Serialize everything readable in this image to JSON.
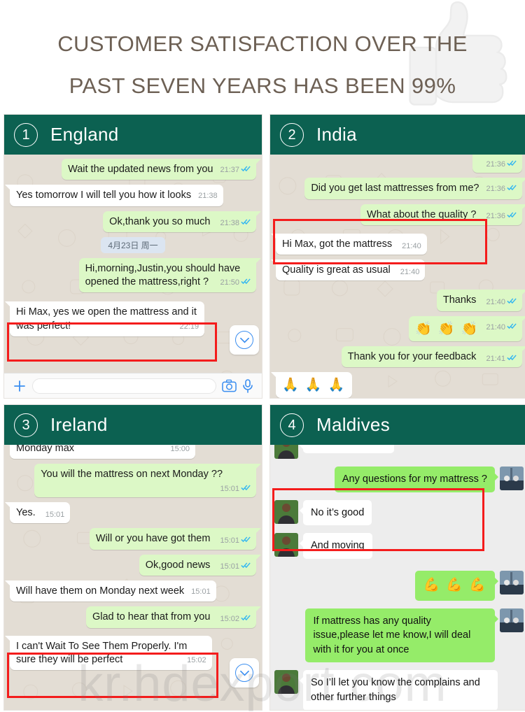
{
  "header": {
    "line1": "CUSTOMER SATISFACTION OVER THE",
    "line2": "PAST SEVEN YEARS HAS BEEN 99%",
    "text_color": "#6d6054",
    "watermark_icon": "thumbs-up-icon"
  },
  "theme": {
    "header_green": "#0c6151",
    "out_bubble_green": "#dcf8c6",
    "in_bubble_white": "#ffffff",
    "chat_background": "#e3ddd4",
    "wechat_background": "#ededed",
    "wechat_out_green": "#95ec69",
    "highlight_red": "#f41c1c",
    "accent_blue": "#3b8ef0",
    "tick_blue": "#34b7f1"
  },
  "panels": [
    {
      "number": "1",
      "title": "England",
      "style": "whatsapp",
      "messages": [
        {
          "side": "right",
          "text": "Wait the updated news from you",
          "time": "21:37",
          "ticks": "read"
        },
        {
          "side": "left",
          "text": "Yes tomorrow I will tell you how it looks",
          "time": "21:38",
          "ticks": "none"
        },
        {
          "side": "right",
          "text": "Ok,thank you so much",
          "time": "21:38",
          "ticks": "read",
          "inline_meta": true
        },
        {
          "side": "center",
          "text": "4月23日 周一",
          "type": "date"
        },
        {
          "side": "right",
          "text": "Hi,morning,Justin,you should have opened the mattress,right ?",
          "time": "21:50",
          "ticks": "read"
        },
        {
          "side": "left",
          "text": "Hi Max, yes we open the mattress and it was perfect!",
          "time": "22:19",
          "ticks": "none",
          "highlighted": true
        }
      ],
      "has_input_bar": true,
      "input_bar": {
        "plus_icon": "plus-icon",
        "input_placeholder": "",
        "camera_icon": "camera-icon",
        "mic_icon": "microphone-icon"
      },
      "scroll_button": {
        "icon": "chevron-down-icon"
      }
    },
    {
      "number": "2",
      "title": "India",
      "style": "whatsapp",
      "messages": [
        {
          "side": "right",
          "text": "",
          "time": "21:36",
          "ticks": "read",
          "clipped": true
        },
        {
          "side": "right",
          "text": "Did you get last mattresses from me?",
          "time": "21:36",
          "ticks": "read"
        },
        {
          "side": "right",
          "text": "What about the quality ?",
          "time": "21:36",
          "ticks": "read",
          "inline_meta": true
        },
        {
          "side": "left",
          "text": "Hi Max, got the mattress",
          "time": "21:40",
          "ticks": "none",
          "inline_meta": true,
          "highlighted": true
        },
        {
          "side": "left",
          "text": "Quality is great as usual",
          "time": "21:40",
          "ticks": "none",
          "inline_meta": true,
          "highlighted": true
        },
        {
          "side": "right",
          "text": "Thanks",
          "time": "21:40",
          "ticks": "read",
          "inline_meta": true
        },
        {
          "side": "right",
          "text": "👏 👏 👏",
          "time": "21:40",
          "ticks": "read",
          "type": "emoji"
        },
        {
          "side": "right",
          "text": "Thank you for your feedback",
          "time": "21:41",
          "ticks": "read",
          "inline_meta": true
        },
        {
          "side": "left",
          "text": "🙏 🙏 🙏",
          "type": "emoji",
          "clipped_bottom": true
        }
      ],
      "has_input_bar": false
    },
    {
      "number": "3",
      "title": "Ireland",
      "style": "whatsapp",
      "messages": [
        {
          "side": "left",
          "text": "Monday max",
          "time": "15:00",
          "ticks": "none",
          "clipped": true
        },
        {
          "side": "right",
          "text": "You will the mattress on next Monday ??",
          "time": "15:01",
          "ticks": "read"
        },
        {
          "side": "left",
          "text": "Yes.",
          "time": "15:01",
          "ticks": "none",
          "inline_meta": true
        },
        {
          "side": "right",
          "text": "Will or you have got them",
          "time": "15:01",
          "ticks": "read",
          "inline_meta": true
        },
        {
          "side": "right",
          "text": "Ok,good news",
          "time": "15:01",
          "ticks": "read",
          "inline_meta": true
        },
        {
          "side": "left",
          "text": "Will have them on Monday next week",
          "time": "15:01",
          "ticks": "none"
        },
        {
          "side": "right",
          "text": "Glad to hear that from you",
          "time": "15:02",
          "ticks": "read",
          "inline_meta": true
        },
        {
          "side": "left",
          "text": "I can't Wait To See Them Properly.  I'm sure they will be perfect",
          "time": "15:02",
          "ticks": "none",
          "highlighted": true
        }
      ],
      "has_input_bar": false,
      "scroll_button": {
        "icon": "chevron-down-icon"
      }
    },
    {
      "number": "4",
      "title": "Maldives",
      "style": "wechat",
      "messages": [
        {
          "side": "left",
          "text": "",
          "avatar": "contact-avatar",
          "clipped": true
        },
        {
          "side": "right",
          "text": "Any questions for my mattress ?",
          "avatar": "user-avatar"
        },
        {
          "side": "left",
          "text": "No it’s good",
          "avatar": "contact-avatar",
          "highlighted": true
        },
        {
          "side": "left",
          "text": "And moving",
          "avatar": "contact-avatar",
          "highlighted": true
        },
        {
          "side": "right",
          "text": "💪 💪 💪",
          "avatar": "user-avatar",
          "type": "emoji"
        },
        {
          "side": "right",
          "text": "If mattress has any quality issue,please let me know,I will deal with it for you at once",
          "avatar": "user-avatar"
        },
        {
          "side": "left",
          "text": "So I’ll let you know the complains and other further things",
          "avatar": "contact-avatar",
          "clipped_bottom": true
        }
      ],
      "has_input_bar": false
    }
  ],
  "watermark": "kr.hdexport.com"
}
